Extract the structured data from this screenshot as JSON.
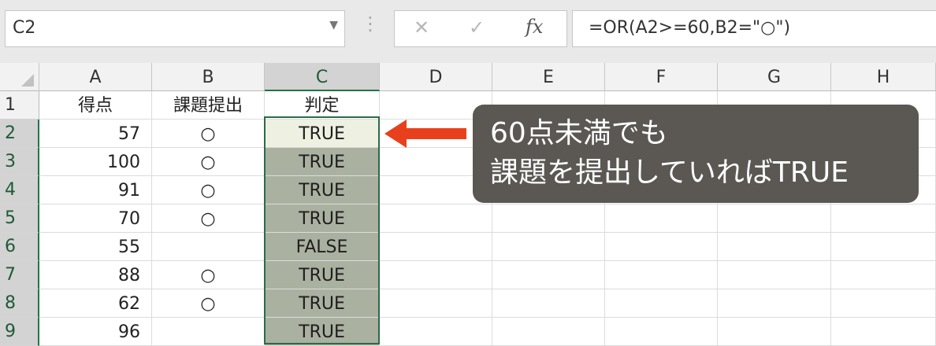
{
  "formula_bar": {
    "name_box": "C2",
    "dropdown_icon": "▼",
    "separator": "⋮",
    "cancel_icon": "✕",
    "enter_icon": "✓",
    "fx_label": "fx",
    "formula": "=OR(A2>=60,B2=\"○\")"
  },
  "columns": [
    "A",
    "B",
    "C",
    "D",
    "E",
    "F",
    "G",
    "H"
  ],
  "selected_column": "C",
  "rows": [
    {
      "num": "1",
      "a": "得点",
      "b": "課題提出",
      "c": "判定"
    },
    {
      "num": "2",
      "a": "57",
      "b": "○",
      "c": "TRUE"
    },
    {
      "num": "3",
      "a": "100",
      "b": "○",
      "c": "TRUE"
    },
    {
      "num": "4",
      "a": "91",
      "b": "○",
      "c": "TRUE"
    },
    {
      "num": "5",
      "a": "70",
      "b": "○",
      "c": "TRUE"
    },
    {
      "num": "6",
      "a": "55",
      "b": "",
      "c": "FALSE"
    },
    {
      "num": "7",
      "a": "88",
      "b": "○",
      "c": "TRUE"
    },
    {
      "num": "8",
      "a": "62",
      "b": "○",
      "c": "TRUE"
    },
    {
      "num": "9",
      "a": "96",
      "b": "",
      "c": "TRUE"
    }
  ],
  "callout": {
    "line1": "60点未満でも",
    "line2": "課題を提出していればTRUE"
  },
  "colors": {
    "selection": "#217346",
    "highlight": "#aab1a0",
    "arrow": "#e8401c",
    "callout_bg": "#5b5753"
  }
}
